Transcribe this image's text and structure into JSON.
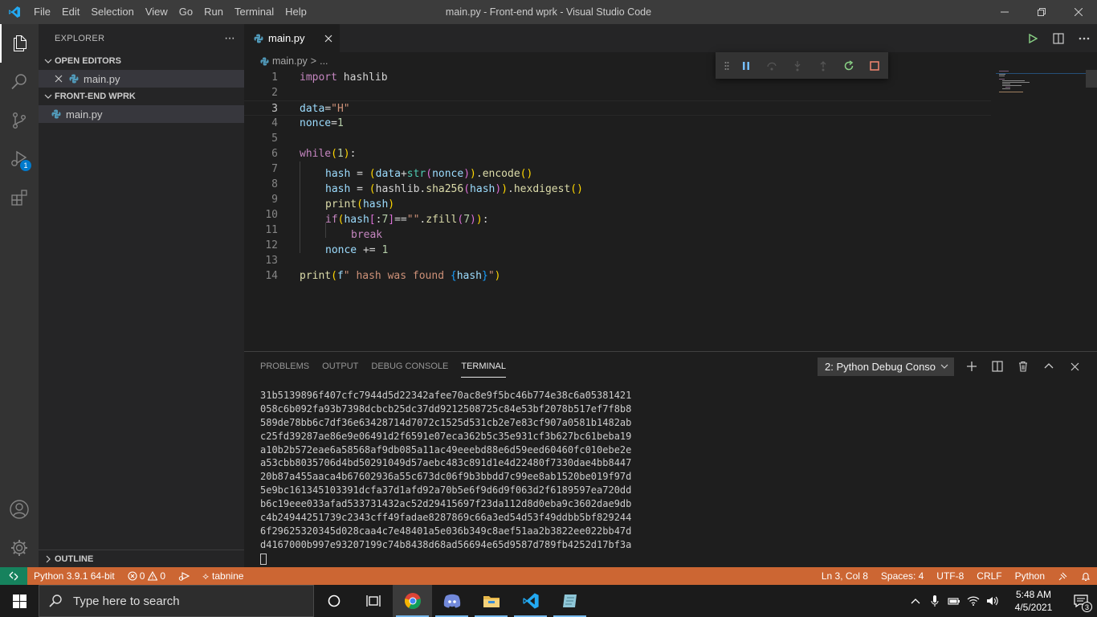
{
  "window": {
    "title": "main.py - Front-end wprk - Visual Studio Code",
    "menu": [
      "File",
      "Edit",
      "Selection",
      "View",
      "Go",
      "Run",
      "Terminal",
      "Help"
    ]
  },
  "activity_bar": {
    "run_badge": "1"
  },
  "sidebar": {
    "header": "EXPLORER",
    "more": "···",
    "open_editors_label": "OPEN EDITORS",
    "open_editors": [
      {
        "name": "main.py"
      }
    ],
    "folder_label": "FRONT-END WPRK",
    "files": [
      {
        "name": "main.py"
      }
    ],
    "outline_label": "OUTLINE"
  },
  "editor": {
    "tab_label": "main.py",
    "breadcrumb": {
      "file": "main.py",
      "sep": ">",
      "rest": "..."
    },
    "current_line": 3,
    "line_numbers": [
      "1",
      "2",
      "3",
      "4",
      "5",
      "6",
      "7",
      "8",
      "9",
      "10",
      "11",
      "12",
      "13",
      "14"
    ]
  },
  "panel": {
    "tabs": [
      "PROBLEMS",
      "OUTPUT",
      "DEBUG CONSOLE",
      "TERMINAL"
    ],
    "active_tab": "TERMINAL",
    "terminal_select": "2: Python Debug Conso",
    "terminal_lines": [
      "31b5139896f407cfc7944d5d22342afee70ac8e9f5bc46b774e38c6a05381421",
      "058c6b092fa93b7398dcbcb25dc37dd9212508725c84e53bf2078b517ef7f8b8",
      "589de78bb6c7df36e63428714d7072c1525d531cb2e7e83cf907a0581b1482ab",
      "c25fd39287ae86e9e06491d2f6591e07eca362b5c35e931cf3b627bc61beba19",
      "a10b2b572eae6a58568af9db085a11ac49eeebd88e6d59eed60460fc010ebe2e",
      "a53cbb8035706d4bd50291049d57aebc483c891d1e4d22480f7330dae4bb8447",
      "20b87a455aaca4b67602936a55c673dc06f9b3bbdd7c99ee8ab1520be019f97d",
      "5e9bc161345103391dcfa37d1afd92a70b5e6f9d6d9f063d2f6189597ea720dd",
      "b6c19eee033afad533731432ac52d29415697f23da112d8d0eba9c3602dae9db",
      "c4b24944251739c2343cff49fadae8287869c66a3ed54d53f49ddbb5bf829244",
      "6f29625320345d028caa4c7e48401a5e036b349c8aef51aa2b3822ee022bb47d",
      "d4167000b997e93207199c74b8438d68ad56694e65d9587d789fb4252d17bf3a"
    ]
  },
  "statusbar": {
    "python": "Python 3.9.1 64-bit",
    "errors": "0",
    "warnings": "0",
    "tabnine": "tabnine",
    "position": "Ln 3, Col 8",
    "spaces": "Spaces: 4",
    "encoding": "UTF-8",
    "eol": "CRLF",
    "language": "Python"
  },
  "taskbar": {
    "search_placeholder": "Type here to search",
    "time": "5:48 AM",
    "date": "4/5/2021",
    "notifications": "3"
  },
  "colors": {
    "statusbar_debug": "#cc6633",
    "activity_bar": "#333333",
    "sidebar": "#252526",
    "editor": "#1e1e1e",
    "accent": "#007acc"
  }
}
